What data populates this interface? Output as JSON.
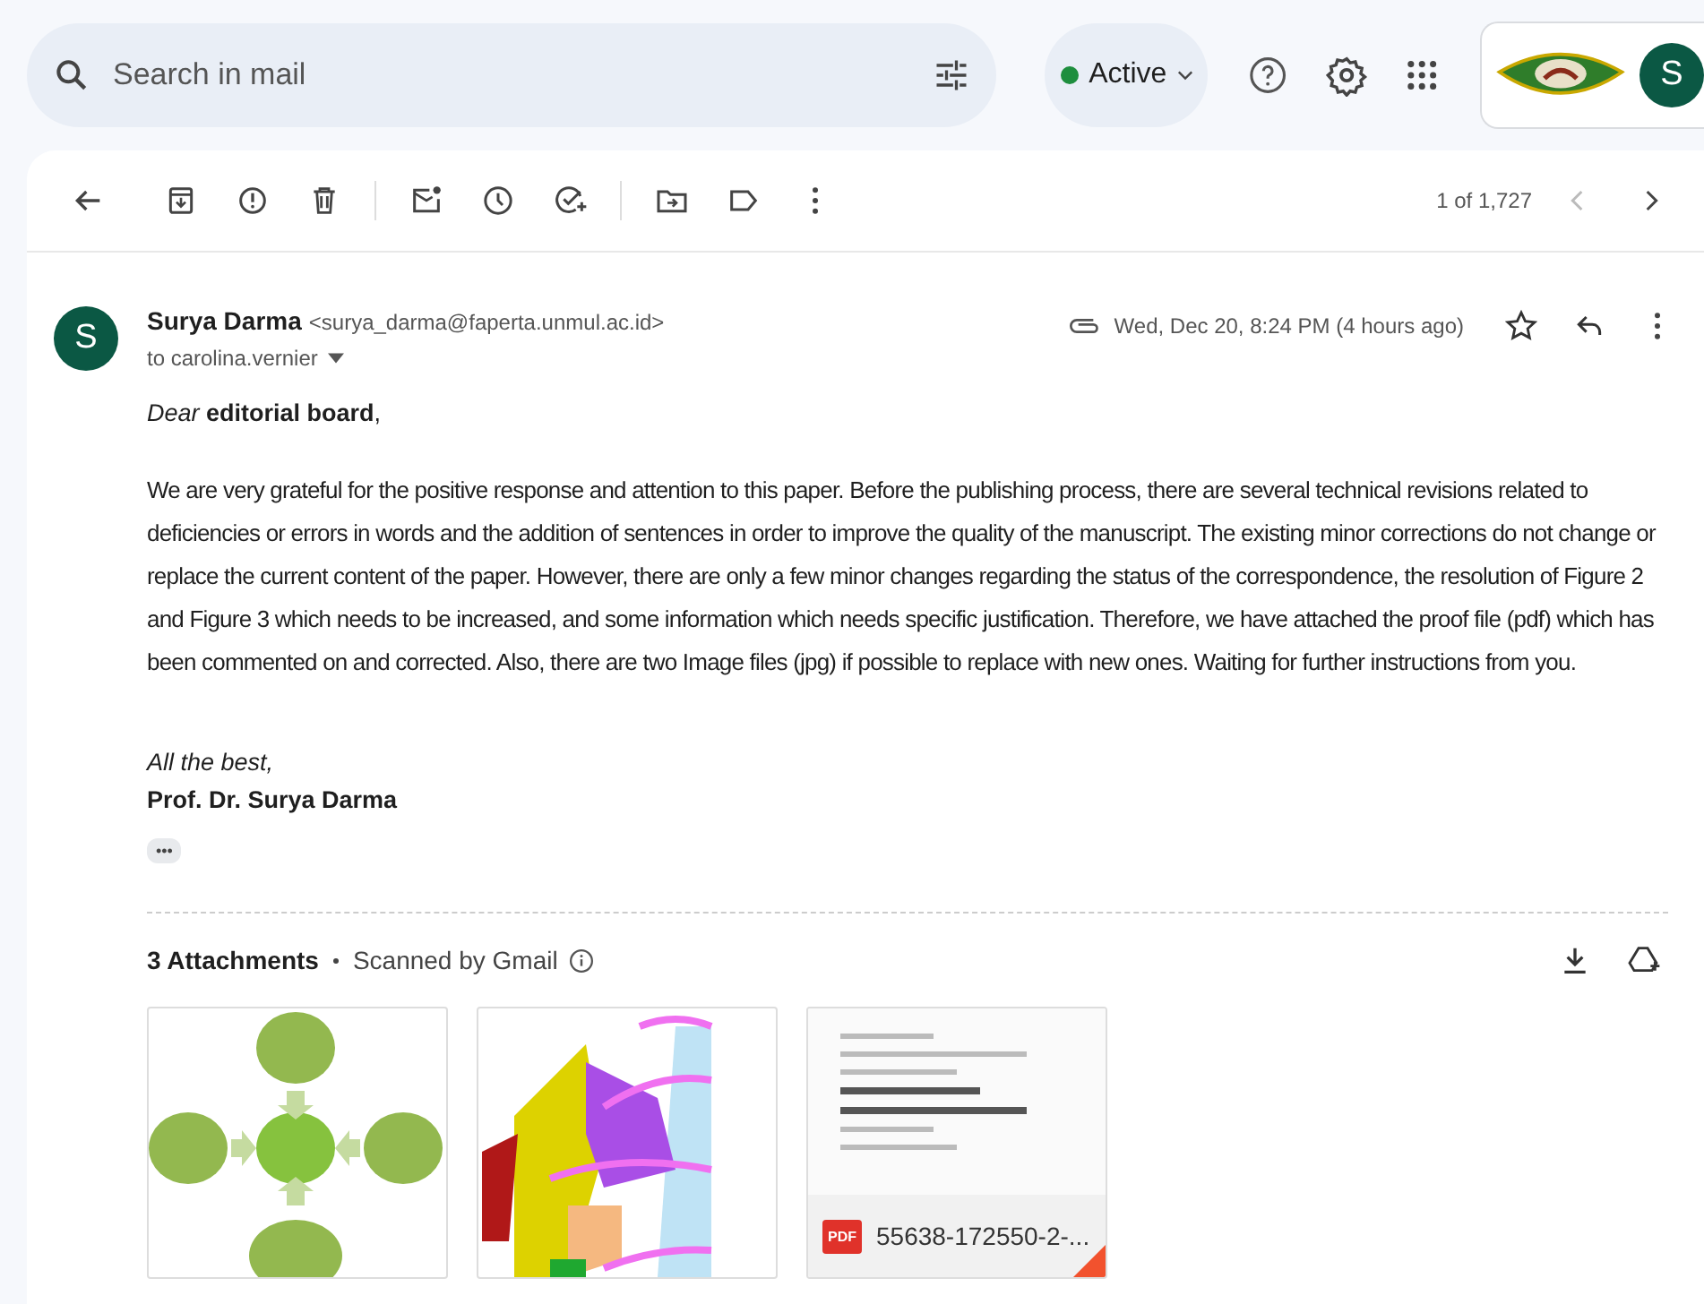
{
  "search": {
    "placeholder": "Search in mail"
  },
  "status": {
    "label": "Active",
    "online": true
  },
  "account": {
    "initial": "S"
  },
  "toolbar": {
    "counter": "1 of 1,727",
    "prev_disabled": true,
    "next_disabled": false
  },
  "message": {
    "sender_initial": "S",
    "sender_name": "Surya Darma",
    "sender_email": "<surya_darma@faperta.unmul.ac.id>",
    "to": "to carolina.vernier",
    "date": "Wed, Dec 20, 8:24 PM (4 hours ago)",
    "has_attachment": true,
    "starred": false,
    "greeting": "*Dear* **editorial board**,",
    "body": "We are very grateful for the positive response and attention to this paper. Before the publishing process, there are several technical revisions related to deficiencies or errors in words and the addition of sentences in order to improve the quality of the manuscript. The existing minor corrections do not change or replace the current content of the paper. However, there are only a few minor changes regarding the status of the correspondence, the resolution of Figure 2 and Figure 3 which needs to be increased, and some information which needs specific justification. Therefore, we have attached the proof file (pdf) which has been commented on and corrected. Also, there are two Image files (jpg) if possible to replace with new ones. Waiting for further instructions from you.",
    "signoff": "All the best,",
    "signature": "Prof. Dr. Surya Darma",
    "trimmed": "•••"
  },
  "attachments": {
    "title": "3 Attachments",
    "scanned": "Scanned by Gmail",
    "items": [
      {
        "kind": "diagram"
      },
      {
        "kind": "map"
      },
      {
        "kind": "document",
        "file_type": "PDF",
        "name": "55638-172550-2-..."
      }
    ]
  }
}
